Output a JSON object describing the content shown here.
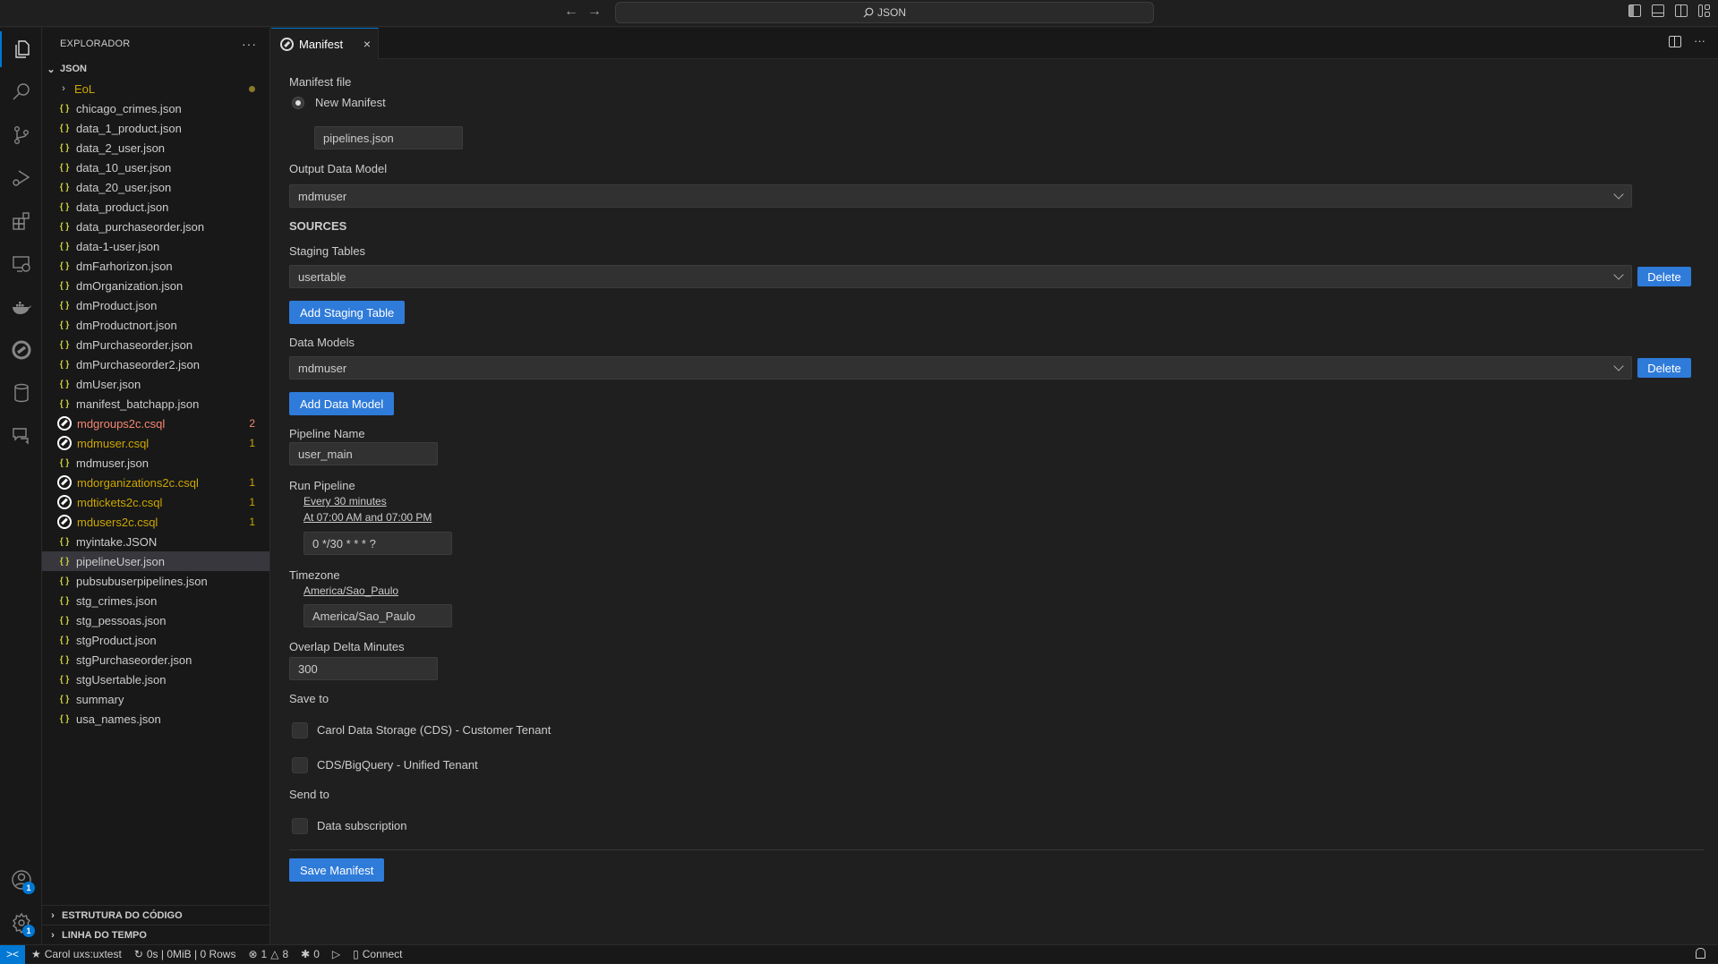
{
  "titlebar": {
    "back_icon": "arrow-left-icon",
    "forward_icon": "arrow-right-icon",
    "search_text": "JSON",
    "layout_icons": [
      "toggle-primary-sidebar-icon",
      "toggle-panel-icon",
      "toggle-secondary-sidebar-icon",
      "customize-layout-icon"
    ]
  },
  "activitybar": {
    "items": [
      "explorer-icon",
      "search-icon",
      "source-control-icon",
      "run-debug-icon",
      "extensions-icon",
      "remote-explorer-icon",
      "docker-icon",
      "carol-icon",
      "database-icon",
      "chat-icon"
    ],
    "accounts_badge": "1",
    "settings_badge": "1"
  },
  "sidebar": {
    "title": "EXPLORADOR",
    "more": "···",
    "root": "JSON",
    "folder": {
      "name": "EoL"
    },
    "files": [
      {
        "name": "chicago_crimes.json",
        "type": "json",
        "status": "",
        "count": ""
      },
      {
        "name": "data_1_product.json",
        "type": "json",
        "status": "",
        "count": ""
      },
      {
        "name": "data_2_user.json",
        "type": "json",
        "status": "",
        "count": ""
      },
      {
        "name": "data_10_user.json",
        "type": "json",
        "status": "",
        "count": ""
      },
      {
        "name": "data_20_user.json",
        "type": "json",
        "status": "",
        "count": ""
      },
      {
        "name": "data_product.json",
        "type": "json",
        "status": "",
        "count": ""
      },
      {
        "name": "data_purchaseorder.json",
        "type": "json",
        "status": "",
        "count": ""
      },
      {
        "name": "data-1-user.json",
        "type": "json",
        "status": "",
        "count": ""
      },
      {
        "name": "dmFarhorizon.json",
        "type": "json",
        "status": "",
        "count": ""
      },
      {
        "name": "dmOrganization.json",
        "type": "json",
        "status": "",
        "count": ""
      },
      {
        "name": "dmProduct.json",
        "type": "json",
        "status": "",
        "count": ""
      },
      {
        "name": "dmProductnort.json",
        "type": "json",
        "status": "",
        "count": ""
      },
      {
        "name": "dmPurchaseorder.json",
        "type": "json",
        "status": "",
        "count": ""
      },
      {
        "name": "dmPurchaseorder2.json",
        "type": "json",
        "status": "",
        "count": ""
      },
      {
        "name": "dmUser.json",
        "type": "json",
        "status": "",
        "count": ""
      },
      {
        "name": "manifest_batchapp.json",
        "type": "json",
        "status": "",
        "count": ""
      },
      {
        "name": "mdgroups2c.csql",
        "type": "csql",
        "status": "err",
        "count": "2"
      },
      {
        "name": "mdmuser.csql",
        "type": "csql",
        "status": "warn",
        "count": "1"
      },
      {
        "name": "mdmuser.json",
        "type": "json",
        "status": "",
        "count": ""
      },
      {
        "name": "mdorganizations2c.csql",
        "type": "csql",
        "status": "warn",
        "count": "1"
      },
      {
        "name": "mdtickets2c.csql",
        "type": "csql",
        "status": "warn",
        "count": "1"
      },
      {
        "name": "mdusers2c.csql",
        "type": "csql",
        "status": "warn",
        "count": "1"
      },
      {
        "name": "myintake.JSON",
        "type": "json",
        "status": "",
        "count": ""
      },
      {
        "name": "pipelineUser.json",
        "type": "json",
        "status": "selected",
        "count": ""
      },
      {
        "name": "pubsubuserpipelines.json",
        "type": "json",
        "status": "",
        "count": ""
      },
      {
        "name": "stg_crimes.json",
        "type": "json",
        "status": "",
        "count": ""
      },
      {
        "name": "stg_pessoas.json",
        "type": "json",
        "status": "",
        "count": ""
      },
      {
        "name": "stgProduct.json",
        "type": "json",
        "status": "",
        "count": ""
      },
      {
        "name": "stgPurchaseorder.json",
        "type": "json",
        "status": "",
        "count": ""
      },
      {
        "name": "stgUsertable.json",
        "type": "json",
        "status": "",
        "count": ""
      },
      {
        "name": "summary",
        "type": "json",
        "status": "",
        "count": ""
      },
      {
        "name": "usa_names.json",
        "type": "json",
        "status": "",
        "count": ""
      }
    ],
    "sections": [
      "ESTRUTURA DO CÓDIGO",
      "LINHA DO TEMPO"
    ]
  },
  "editor": {
    "tab_label": "Manifest",
    "close": "×",
    "actions_more": "···",
    "form": {
      "manifest_file_label": "Manifest file",
      "new_manifest_label": "New Manifest",
      "manifest_filename": "pipelines.json",
      "output_model_label": "Output Data Model",
      "output_model_value": "mdmuser",
      "sources_heading": "SOURCES",
      "staging_tables_label": "Staging Tables",
      "staging_table_value": "usertable",
      "delete_label": "Delete",
      "add_staging_label": "Add Staging Table",
      "data_models_label": "Data Models",
      "data_model_value": "mdmuser",
      "add_data_model_label": "Add Data Model",
      "pipeline_name_label": "Pipeline Name",
      "pipeline_name_value": "user_main",
      "run_pipeline_label": "Run Pipeline",
      "run_link_1": "Every 30 minutes",
      "run_link_2": "At 07:00 AM and 07:00 PM",
      "cron_value": "0 */30 * * * ?",
      "timezone_label": "Timezone",
      "timezone_link": "America/Sao_Paulo",
      "timezone_value": "America/Sao_Paulo",
      "overlap_label": "Overlap Delta Minutes",
      "overlap_value": "300",
      "save_to_label": "Save to",
      "save_option_1": "Carol Data Storage (CDS) - Customer Tenant",
      "save_option_2": "CDS/BigQuery - Unified Tenant",
      "send_to_label": "Send to",
      "send_option_1": "Data subscription",
      "save_button": "Save Manifest"
    }
  },
  "statusbar": {
    "remote_icon": "remote-icon",
    "env": "Carol uxs:uxtest",
    "query_stats": "0s | 0MiB | 0 Rows",
    "errors": "1",
    "warnings": "8",
    "ports": "0",
    "connect": "Connect"
  },
  "colors": {
    "accent": "#0078d4",
    "button": "#2f7bd9",
    "warning": "#cca700",
    "error": "#f48771",
    "json_icon": "#cbcb41"
  }
}
